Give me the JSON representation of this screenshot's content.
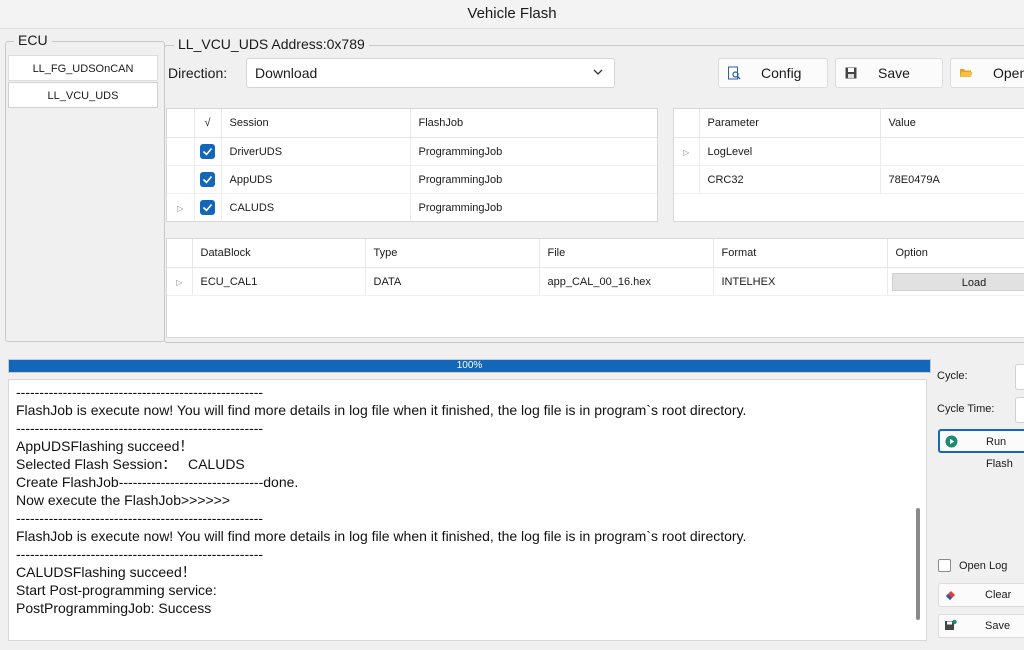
{
  "window": {
    "title": "Vehicle Flash"
  },
  "ecu": {
    "title": "ECU",
    "items": [
      {
        "label": "LL_FG_UDSOnCAN"
      },
      {
        "label": "LL_VCU_UDS"
      }
    ]
  },
  "address_group": {
    "title": "LL_VCU_UDS Address:0x789"
  },
  "direction": {
    "label": "Direction:",
    "value": "Download"
  },
  "toolbar": {
    "config_label": "Config",
    "save_label": "Save",
    "open_label": "Open"
  },
  "session_table": {
    "headers": {
      "check": "√",
      "session": "Session",
      "flashjob": "FlashJob"
    },
    "rows": [
      {
        "session": "DriverUDS",
        "flashjob": "ProgrammingJob",
        "checked": true
      },
      {
        "session": "AppUDS",
        "flashjob": "ProgrammingJob",
        "checked": true
      },
      {
        "session": "CALUDS",
        "flashjob": "ProgrammingJob",
        "checked": true
      }
    ]
  },
  "param_table": {
    "headers": {
      "parameter": "Parameter",
      "value": "Value"
    },
    "rows": [
      {
        "parameter": "LogLevel",
        "value": ""
      },
      {
        "parameter": "CRC32",
        "value": "78E0479A"
      }
    ]
  },
  "datablock_table": {
    "headers": {
      "datablock": "DataBlock",
      "type": "Type",
      "file": "File",
      "format": "Format",
      "option": "Option"
    },
    "rows": [
      {
        "datablock": "ECU_CAL1",
        "type": "DATA",
        "file": "app_CAL_00_16.hex",
        "format": "INTELHEX",
        "option": "Load"
      }
    ]
  },
  "progress": {
    "percent": 100,
    "text": "100%"
  },
  "log": {
    "lines": [
      "-----------------------------------------------------",
      "FlashJob is execute now! You will find more details in log file when it finished, the log file is in program`s root directory.",
      "-----------------------------------------------------",
      "AppUDSFlashing succeed！",
      "Selected Flash Session：   CALUDS",
      "Create FlashJob-------------------------------done.",
      "Now execute the FlashJob>>>>>>",
      "-----------------------------------------------------",
      "FlashJob is execute now! You will find more details in log file when it finished, the log file is in program`s root directory.",
      "-----------------------------------------------------",
      "CALUDSFlashing succeed！",
      "Start Post-programming service:",
      "PostProgrammingJob: Success"
    ]
  },
  "right_panel": {
    "cycle_label": "Cycle:",
    "cycle_time_label": "Cycle Time:",
    "run_flash_label": "Run Flash",
    "open_log_label": "Open Log",
    "clear_label": "Clear",
    "save_label": "Save"
  },
  "colors": {
    "accent": "#1466b8",
    "run_icon": "#1e8a6e"
  }
}
